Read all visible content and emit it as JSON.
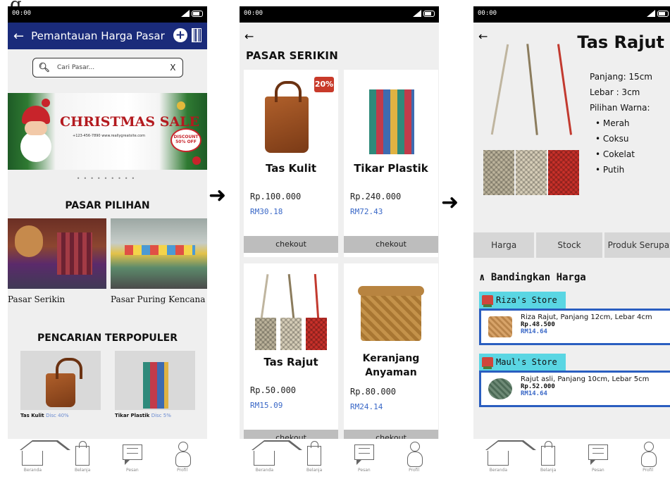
{
  "corner_letter": "g",
  "status": {
    "time": "00:00"
  },
  "screen1": {
    "header_title": "Pemantauan Harga Pasar",
    "search_placeholder": "Cari Pasar...",
    "search_clear": "X",
    "banner": {
      "title": "CHRISTMAS SALE",
      "contact": "+123-456-7890   www.reallygreatsite.com",
      "discount": "DISCOUNT 50% OFF"
    },
    "carousel_dots": "•••••••••",
    "section_pasar": "PASAR PILIHAN",
    "markets": [
      {
        "label": "Pasar Serikin"
      },
      {
        "label": "Pasar Puring Kencana"
      }
    ],
    "section_popular": "PENCARIAN TERPOPULER",
    "popular": [
      {
        "name": "Tas Kulit",
        "disc": "Disc 40%"
      },
      {
        "name": "Tikar Plastik",
        "disc": "Disc 5%"
      }
    ]
  },
  "screen2": {
    "title": "PASAR SERIKIN",
    "checkout_label": "chekout",
    "badge": "20%",
    "products": [
      {
        "name": "Tas Kulit",
        "price": "Rp.100.000",
        "rm": "RM30.18"
      },
      {
        "name": "Tikar Plastik",
        "price": "Rp.240.000",
        "rm": "RM72.43"
      },
      {
        "name": "Tas Rajut",
        "price": "Rp.50.000",
        "rm": "RM15.09"
      },
      {
        "name": "Keranjang Anyaman",
        "price": "Rp.80.000",
        "rm": "RM24.14"
      }
    ]
  },
  "screen3": {
    "title": "Tas Rajut",
    "panjang": "Panjang: 15cm",
    "lebar": "Lebar : 3cm",
    "pilihan": "Pilihan Warna:",
    "colors": [
      "• Merah",
      "• Coksu",
      "• Cokelat",
      "• Putih"
    ],
    "tabs": [
      "Harga",
      "Stock",
      "Produk Serupa"
    ],
    "compare_title": "∧ Bandingkan Harga",
    "stores": [
      {
        "name": "Riza's Store",
        "desc": "Riza Rajut, Panjang 12cm, Lebar 4cm",
        "price": "Rp.48.500",
        "rm": "RM14.64"
      },
      {
        "name": "Maul's Store",
        "desc": "Rajut asli, Panjang 10cm, Lebar 5cm",
        "price": "Rp.52.000",
        "rm": "RM14.64"
      }
    ]
  },
  "nav": [
    "Beranda",
    "Belanja",
    "Pesan",
    "Profil"
  ],
  "colors": {
    "header": "#1a2b7a",
    "store_tag": "#5ad6e3",
    "offer_border": "#2a5ec0",
    "rm_text": "#3a68c7"
  }
}
